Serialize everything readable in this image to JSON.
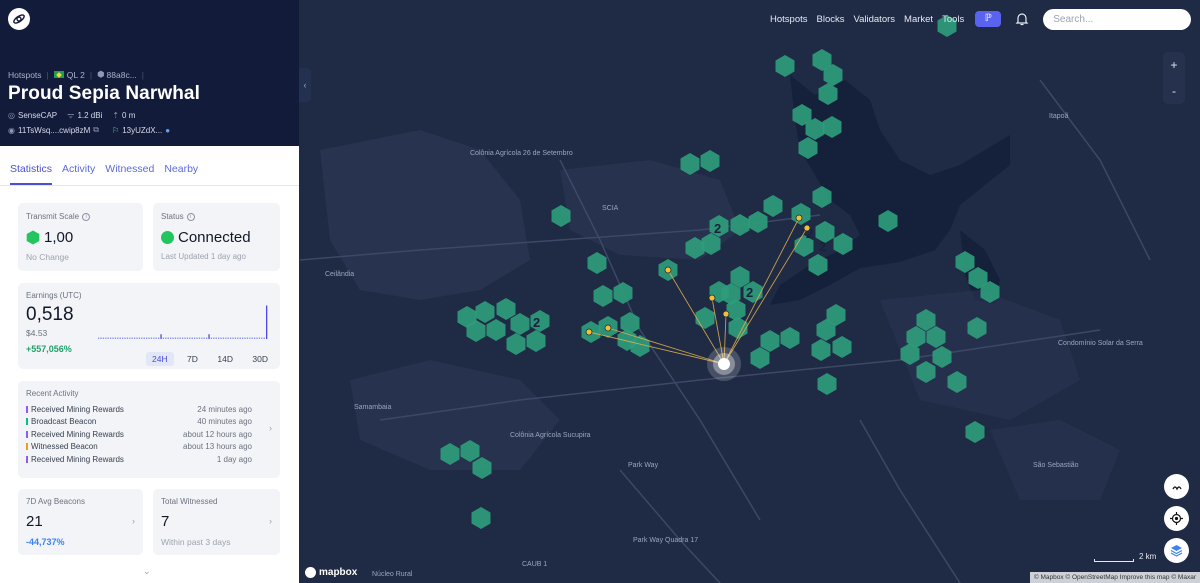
{
  "sidebar": {
    "breadcrumb": {
      "section": "Hotspots",
      "region": "QL 2",
      "hex": "88a8c..."
    },
    "title": "Proud Sepia Narwhal",
    "meta": {
      "maker": "SenseCAP",
      "antenna": "1.2 dBi",
      "elevation": "0 m",
      "owner": "11TsWsq....cwip8zM",
      "location_id": "13yUZdX..."
    },
    "tabs": [
      {
        "label": "Statistics",
        "active": true
      },
      {
        "label": "Activity"
      },
      {
        "label": "Witnessed"
      },
      {
        "label": "Nearby"
      }
    ],
    "transmit": {
      "label": "Transmit Scale",
      "value": "1,00",
      "note": "No Change"
    },
    "status": {
      "label": "Status",
      "value": "Connected",
      "note": "Last Updated 1 day ago"
    },
    "earnings": {
      "label": "Earnings (UTC)",
      "value": "0,518",
      "usd": "$4.53",
      "change": "+557,056%",
      "ranges": [
        "24H",
        "7D",
        "14D",
        "30D"
      ],
      "active_range": "24H",
      "bar_levels": [
        0,
        0,
        0,
        0,
        0,
        0,
        0,
        0,
        0,
        0,
        0,
        0,
        0,
        0,
        0,
        0,
        0,
        0,
        0,
        0,
        0,
        0,
        0,
        0,
        0,
        0,
        1,
        0,
        0,
        0,
        0,
        0,
        0,
        0,
        0,
        0,
        0,
        0,
        0,
        0,
        0,
        0,
        0,
        0,
        0,
        0,
        1,
        0,
        0,
        0,
        0,
        0,
        0,
        0,
        0,
        0,
        0,
        0,
        0,
        0,
        0,
        0,
        0,
        0,
        0,
        0,
        0,
        0,
        0,
        0,
        10
      ]
    },
    "recent_activity": {
      "label": "Recent Activity",
      "items": [
        {
          "name": "Received Mining Rewards",
          "time": "24 minutes ago",
          "color": "#8b5cf6"
        },
        {
          "name": "Broadcast Beacon",
          "time": "40 minutes ago",
          "color": "#10b981"
        },
        {
          "name": "Received Mining Rewards",
          "time": "about 12 hours ago",
          "color": "#8b5cf6"
        },
        {
          "name": "Witnessed Beacon",
          "time": "about 13 hours ago",
          "color": "#f59e0b"
        },
        {
          "name": "Received Mining Rewards",
          "time": "1 day ago",
          "color": "#8b5cf6"
        }
      ]
    },
    "beacons": {
      "label": "7D Avg Beacons",
      "value": "21",
      "change": "-44,737%"
    },
    "witnessed": {
      "label": "Total Witnessed",
      "value": "7",
      "note": "Within past 3 days"
    }
  },
  "nav": {
    "links": [
      "Hotspots",
      "Blocks",
      "Validators",
      "Market",
      "Tools"
    ],
    "pill": "ℙ"
  },
  "search": {
    "placeholder": "Search..."
  },
  "zoom": {
    "in": "+",
    "out": "-"
  },
  "map": {
    "places": [
      "Itapoã",
      "Colônia Agrícola 26 de Setembro",
      "SCIA",
      "Ceilândia",
      "Samambaia",
      "Colônia Agrícola Sucupira",
      "Park Way",
      "Park Way Quadra 17",
      "Condomínio Solar da Serra",
      "São Sebastião",
      "CAUB 1",
      "Núcleo Rural"
    ],
    "scale": "2 km",
    "logo": "mapbox",
    "attribution": "© Mapbox © OpenStreetMap Improve this map © Maxar",
    "hex_count_labels": [
      "2",
      "2",
      "2",
      "2",
      "2"
    ],
    "colors": {
      "hex": "#2f9c7b",
      "witness": "#f2c230",
      "link": "#e2b24d"
    }
  }
}
